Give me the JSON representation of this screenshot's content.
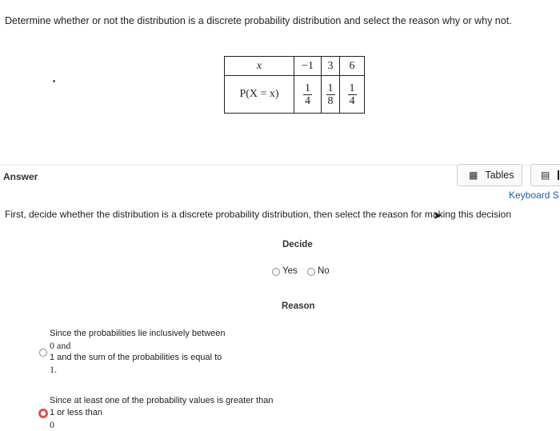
{
  "question": {
    "text": "Determine whether or not the distribution is a discrete probability distribution and select the reason why or why not."
  },
  "table": {
    "row1_label": "x",
    "row2_label": "P(X = x)",
    "x_values": [
      "−1",
      "3",
      "6"
    ],
    "p_numerators": [
      "1",
      "1",
      "1"
    ],
    "p_denominators": [
      "4",
      "8",
      "4"
    ]
  },
  "answer": {
    "label": "Answer",
    "tables_button": "Tables",
    "keyboard_link": "Keyboard S",
    "instruction": "First, decide whether the distribution is a discrete probability distribution, then select the reason for making this decision"
  },
  "decide": {
    "heading": "Decide",
    "yes_label": "Yes",
    "no_label": "No"
  },
  "reason": {
    "heading": "Reason",
    "option1": {
      "line1": "Since the probabilities lie inclusively between",
      "line2": "0 and",
      "line3": "1 and the sum of the probabilities is equal to",
      "line4": "1."
    },
    "option2": {
      "line1": "Since at least one of the probability values is greater than",
      "line2": "1 or less than",
      "line3": "0"
    }
  },
  "colors": {
    "link": "#1f5fa8",
    "selected_radio": "#d9534f"
  }
}
